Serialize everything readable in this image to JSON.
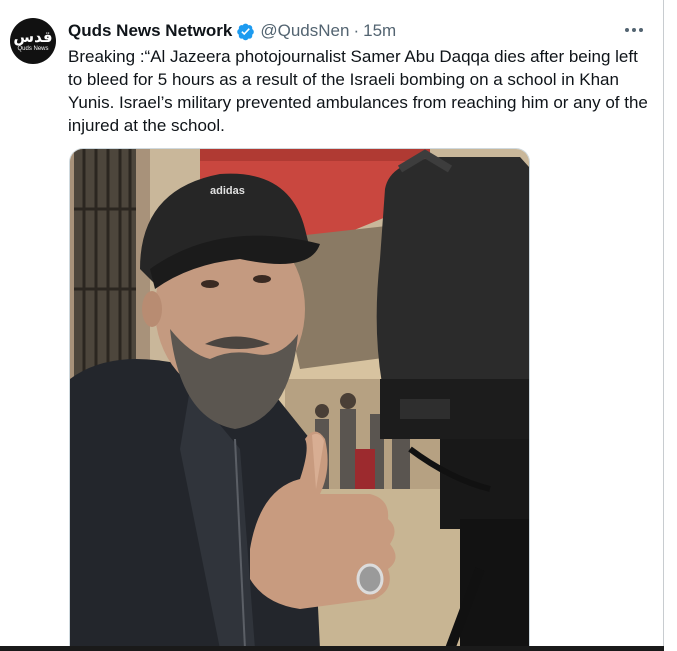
{
  "author": {
    "name": "Quds News Network",
    "handle": "@QudsNen",
    "time": "15m",
    "separator": "·",
    "avatar_logo": "قدس",
    "avatar_subtext": "Quds News"
  },
  "tweet": {
    "text": "Breaking :“Al Jazeera photojournalist Samer Abu Daqqa dies after being left to bleed for 5 hours as a result of the Israeli bombing on a school in Khan Yunis. Israel’s military prevented ambulances from reaching him or any of the injured at the school."
  },
  "media": {
    "cap_logo": "adidas"
  },
  "icons": {
    "verified": "verified-badge-icon",
    "more": "more-options-icon"
  },
  "colors": {
    "verified": "#1d9bf0",
    "secondary_text": "#536471",
    "primary_text": "#0f1419"
  }
}
